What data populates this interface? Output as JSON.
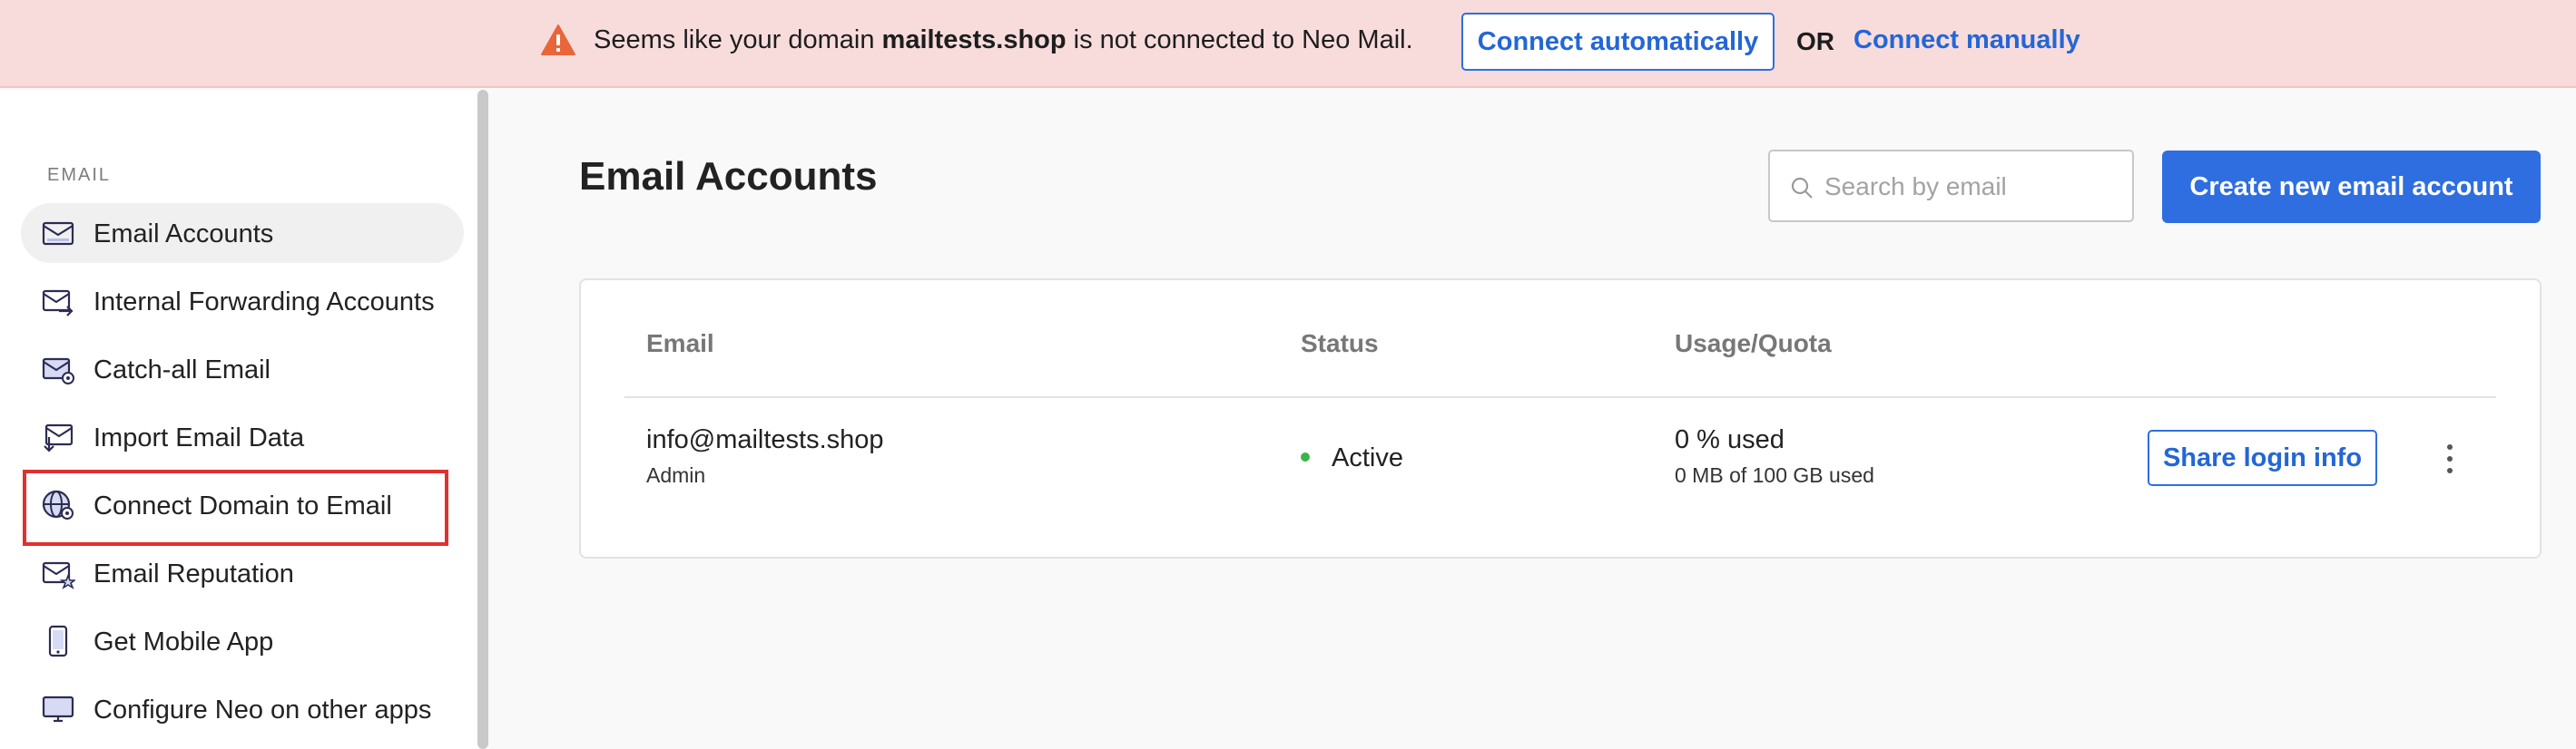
{
  "banner": {
    "text_prefix": "Seems like your domain ",
    "domain": "mailtests.shop",
    "text_suffix": " is not connected to Neo Mail.",
    "connect_auto_label": "Connect automatically",
    "or_label": "OR",
    "connect_manual_label": "Connect manually",
    "icon": "warning-icon",
    "bg_color": "#f8dcdc",
    "icon_color": "#e8663a"
  },
  "sidebar": {
    "section_label": "EMAIL",
    "items": [
      {
        "label": "Email Accounts",
        "icon": "envelope-icon",
        "active": true
      },
      {
        "label": "Internal Forwarding Accounts",
        "icon": "forward-mail-icon",
        "active": false
      },
      {
        "label": "Catch-all Email",
        "icon": "catch-all-mail-icon",
        "active": false
      },
      {
        "label": "Import Email Data",
        "icon": "import-mail-icon",
        "active": false
      },
      {
        "label": "Connect Domain to Email",
        "icon": "globe-gear-icon",
        "active": false,
        "highlighted": true
      },
      {
        "label": "Email Reputation",
        "icon": "reputation-mail-icon",
        "active": false
      },
      {
        "label": "Get Mobile App",
        "icon": "mobile-phone-icon",
        "active": false
      },
      {
        "label": "Configure Neo on other apps",
        "icon": "monitor-icon",
        "active": false
      }
    ]
  },
  "main": {
    "title": "Email Accounts",
    "search_placeholder": "Search by email",
    "create_button_label": "Create new email account",
    "accent_color": "#2f6ee0"
  },
  "table": {
    "headers": [
      "Email",
      "Status",
      "Usage/Quota"
    ],
    "rows": [
      {
        "email": "info@mailtests.shop",
        "role": "Admin",
        "status": "Active",
        "status_color": "#3ab54a",
        "usage": "0 % used",
        "quota": "0 MB of 100 GB used",
        "share_label": "Share login info"
      }
    ]
  }
}
